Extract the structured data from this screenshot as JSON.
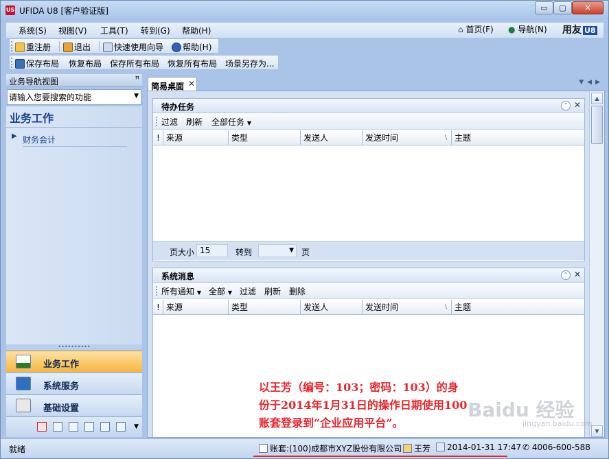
{
  "window": {
    "logo": "US",
    "title": "UFIDA U8 [客户验证版]",
    "controls": {
      "minimize": "▭",
      "maximize": "▢",
      "close": "✕"
    }
  },
  "menu": {
    "items": [
      "系统(S)",
      "视图(V)",
      "工具(T)",
      "转到(G)",
      "帮助(H)"
    ],
    "home": "首页(F)",
    "navigate": "导航(N)",
    "brand": "用友",
    "brand_suffix": "U8"
  },
  "toolbar1": {
    "items": [
      "重注册",
      "退出",
      "快速使用向导",
      "帮助(H)"
    ]
  },
  "toolbar2": {
    "items": [
      "保存布局",
      "恢复布局",
      "保存所有布局",
      "恢复所有布局",
      "场景另存为..."
    ]
  },
  "nav": {
    "title": "业务导航视图",
    "pin": "ꟸ",
    "search_placeholder": "请输入您要搜索的功能",
    "section": "业务工作",
    "item": "财务会计",
    "buttons": [
      "业务工作",
      "系统服务",
      "基础设置"
    ],
    "splitter": "••••••••••"
  },
  "tabs": {
    "active": "简易桌面",
    "close": "✕"
  },
  "todo": {
    "title": "待办任务",
    "toolbar": [
      "过滤",
      "刷新",
      "全部任务"
    ],
    "columns": [
      "!",
      "来源",
      "类型",
      "发送人",
      "发送时间",
      "主题"
    ],
    "page_size_label": "页大小",
    "page_size": "15",
    "goto_label": "转到",
    "page_unit": "页"
  },
  "messages": {
    "title": "系统消息",
    "toolbar": [
      "所有通知",
      "全部",
      "过滤",
      "刷新",
      "删除"
    ],
    "columns": [
      "!",
      "来源",
      "类型",
      "发送人",
      "发送时间",
      "主题"
    ]
  },
  "annotation": {
    "line1": "以王芳（编号：103；密码：103）的身",
    "line2": "份于2014年1月31日的操作日期使用100",
    "line3": "账套登录到“企业应用平台”。"
  },
  "watermark": {
    "main": "Baidu 经验",
    "sub": "jingyan.baidu.com"
  },
  "status": {
    "ready": "就绪",
    "account": "账套:(100)成都市XYZ股份有限公司",
    "user": "王芳",
    "datetime": "2014-01-31 17:47",
    "phone": "4006-600-588"
  }
}
